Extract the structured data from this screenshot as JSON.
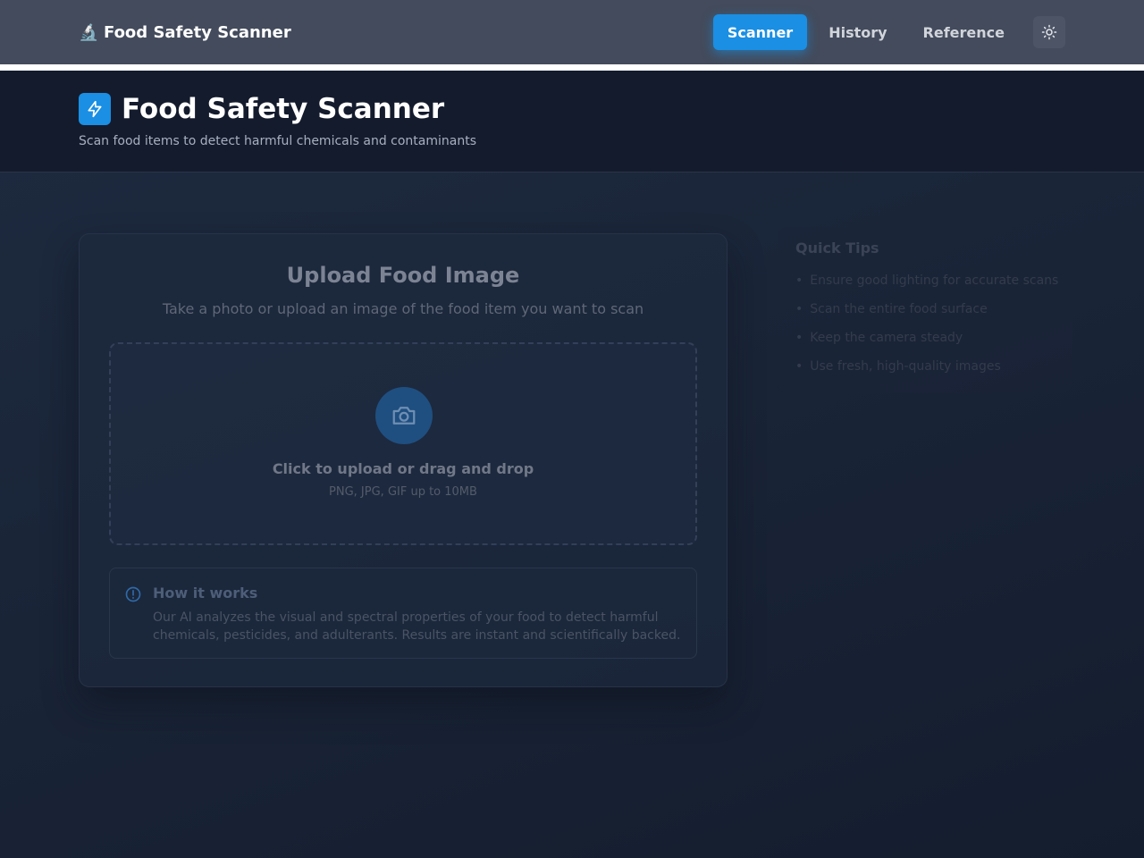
{
  "nav": {
    "brand_icon": "microscope-icon",
    "brand": "Food Safety Scanner",
    "links": [
      {
        "label": "Scanner",
        "active": true
      },
      {
        "label": "History",
        "active": false
      },
      {
        "label": "Reference",
        "active": false
      }
    ],
    "theme_icon": "sun-icon"
  },
  "header": {
    "badge_icon": "lightning-icon",
    "title": "Food Safety Scanner",
    "subtitle": "Scan food items to detect harmful chemicals and contaminants"
  },
  "upload": {
    "title": "Upload Food Image",
    "description": "Take a photo or upload an image of the food item you want to scan",
    "dropzone": {
      "icon": "camera-icon",
      "title": "Click to upload or drag and drop",
      "hint": "PNG, JPG, GIF up to 10MB"
    },
    "how_it_works": {
      "icon": "info-icon",
      "title": "How it works",
      "text": "Our AI analyzes the visual and spectral properties of your food to detect harmful chemicals, pesticides, and adulterants. Results are instant and scientifically backed."
    }
  },
  "tips": {
    "title": "Quick Tips",
    "items": [
      "Ensure good lighting for accurate scans",
      "Scan the entire food surface",
      "Keep the camera steady",
      "Use fresh, high-quality images"
    ]
  },
  "colors": {
    "accent": "#1a8fe3",
    "navbar": "#434b5c",
    "header": "#141b2d"
  }
}
